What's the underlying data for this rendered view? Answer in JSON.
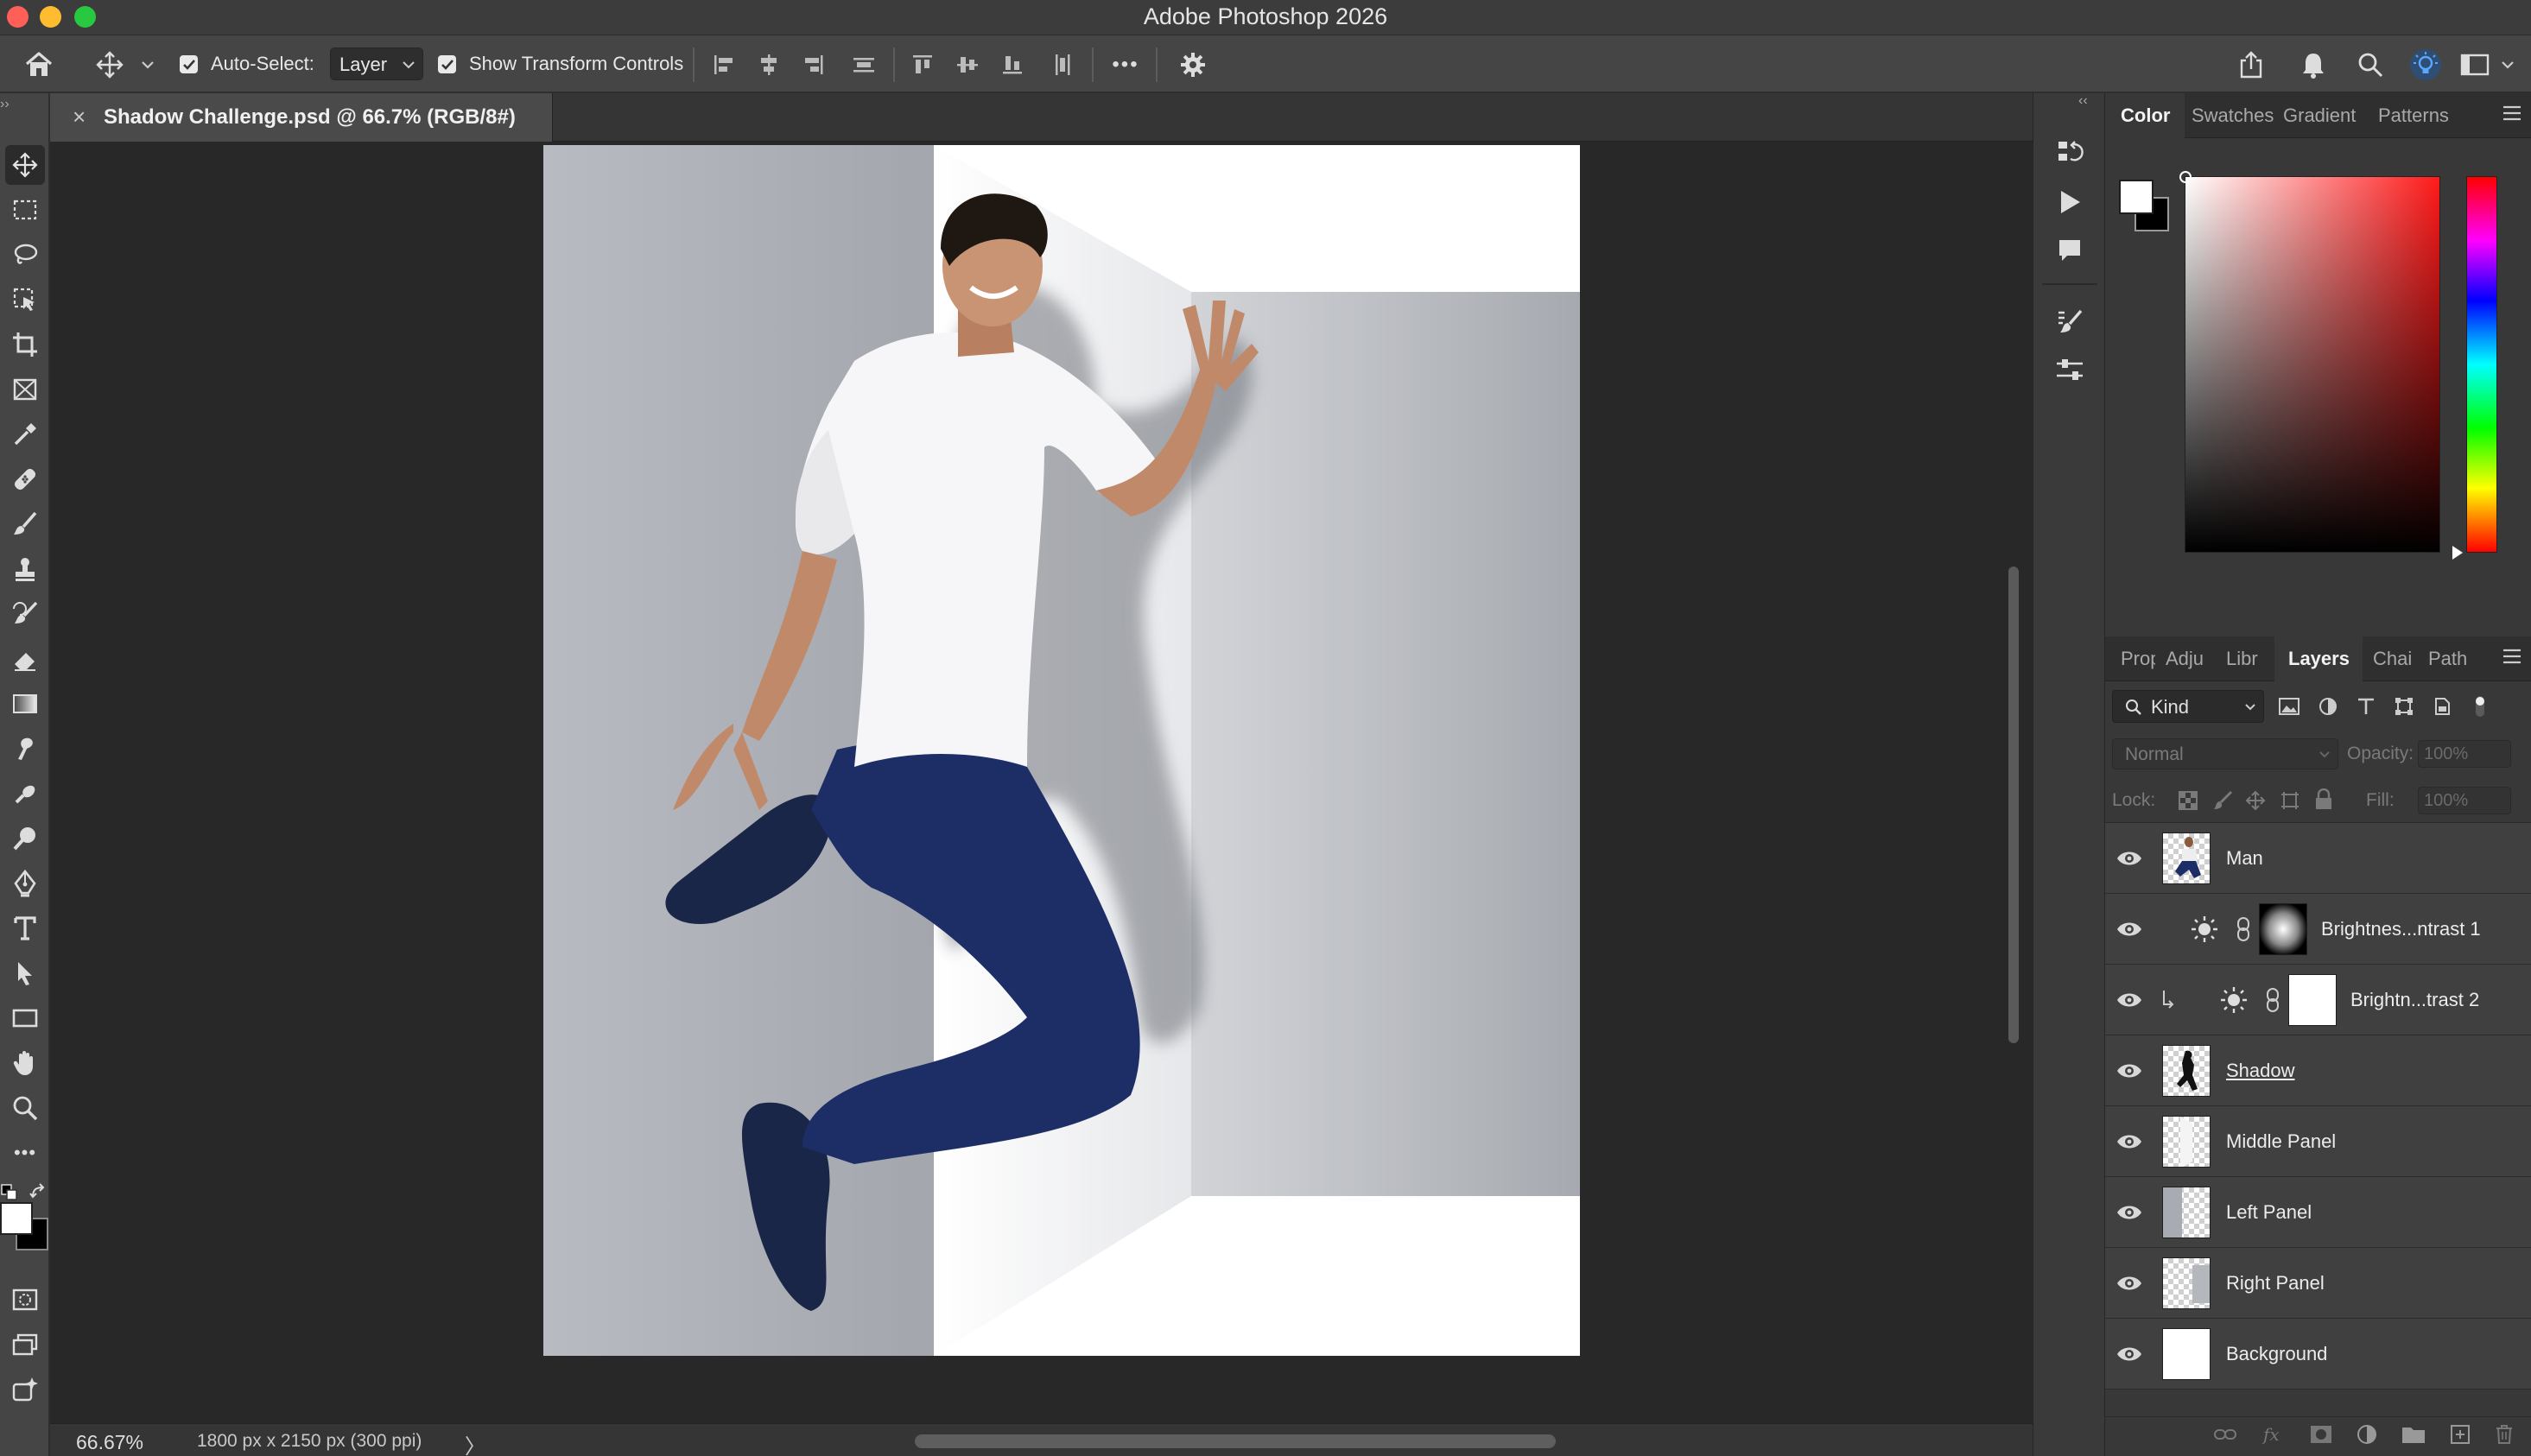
{
  "app": {
    "title": "Adobe Photoshop 2026"
  },
  "options_bar": {
    "auto_select_label": "Auto-Select:",
    "auto_select_checked": true,
    "auto_select_target": "Layer",
    "show_transform_label": "Show Transform Controls",
    "show_transform_checked": true,
    "more_label": "•••"
  },
  "document": {
    "tab_title": "Shadow Challenge.psd @ 66.7% (RGB/8#)",
    "tab_close": "×",
    "zoom": "66.67%",
    "info": "1800 px x 2150 px (300 ppi)",
    "status_arrow": "〉"
  },
  "color_panel": {
    "tabs": [
      "Color",
      "Swatches",
      "Gradient",
      "Patterns"
    ],
    "active_tab": "Color",
    "foreground": "#ffffff",
    "background": "#000000"
  },
  "layers_panel": {
    "tabs": [
      "Properties",
      "Adjustments",
      "Libraries",
      "Layers",
      "Channels",
      "Paths"
    ],
    "tab_labels": [
      "Prop",
      "Adju",
      "Libr",
      "Layers",
      "Chai",
      "Path"
    ],
    "active_tab": "Layers",
    "kind_filter": "Kind",
    "blend_mode": "Normal",
    "opacity_label": "Opacity:",
    "opacity_value": "100%",
    "lock_label": "Lock:",
    "fill_label": "Fill:",
    "fill_value": "100%",
    "layers": [
      {
        "name": "Man",
        "visible": true,
        "type": "pixel"
      },
      {
        "name": "Brightnes...ntrast 1",
        "visible": true,
        "type": "adjustment",
        "mask": "gradient"
      },
      {
        "name": "Brightn...trast 2",
        "visible": true,
        "type": "adjustment",
        "clipped": true,
        "mask": "white"
      },
      {
        "name": "Shadow",
        "visible": true,
        "type": "pixel",
        "underlined": true
      },
      {
        "name": "Middle Panel",
        "visible": true,
        "type": "pixel"
      },
      {
        "name": "Left Panel",
        "visible": true,
        "type": "pixel"
      },
      {
        "name": "Right Panel",
        "visible": true,
        "type": "pixel"
      },
      {
        "name": "Background",
        "visible": true,
        "type": "pixel"
      }
    ]
  },
  "colors": {
    "accent_active_icon": "#5ba7ff",
    "titlebar": "#3c3c3c",
    "panel_bg": "#383838"
  }
}
